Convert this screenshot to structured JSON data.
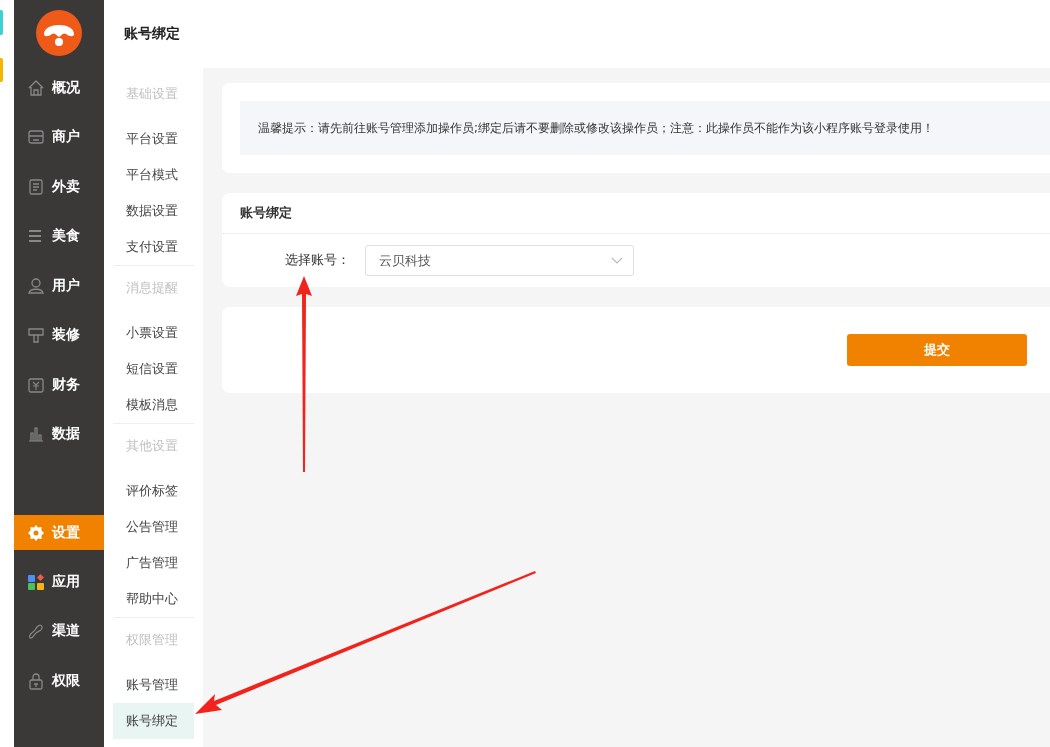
{
  "page_title": "账号绑定",
  "nav": [
    {
      "label": "概况",
      "selected": false
    },
    {
      "label": "商户",
      "selected": false
    },
    {
      "label": "外卖",
      "selected": false
    },
    {
      "label": "美食",
      "selected": false
    },
    {
      "label": "用户",
      "selected": false
    },
    {
      "label": "装修",
      "selected": false
    },
    {
      "label": "财务",
      "selected": false
    },
    {
      "label": "数据",
      "selected": false
    },
    {
      "label": "设置",
      "selected": true
    },
    {
      "label": "应用",
      "selected": false
    },
    {
      "label": "渠道",
      "selected": false
    },
    {
      "label": "权限",
      "selected": false
    }
  ],
  "submenu": [
    {
      "title": "基础设置",
      "items": [
        {
          "label": "平台设置",
          "selected": false
        },
        {
          "label": "平台模式",
          "selected": false
        },
        {
          "label": "数据设置",
          "selected": false
        },
        {
          "label": "支付设置",
          "selected": false
        }
      ]
    },
    {
      "title": "消息提醒",
      "items": [
        {
          "label": "小票设置",
          "selected": false
        },
        {
          "label": "短信设置",
          "selected": false
        },
        {
          "label": "模板消息",
          "selected": false
        }
      ]
    },
    {
      "title": "其他设置",
      "items": [
        {
          "label": "评价标签",
          "selected": false
        },
        {
          "label": "公告管理",
          "selected": false
        },
        {
          "label": "广告管理",
          "selected": false
        },
        {
          "label": "帮助中心",
          "selected": false
        }
      ]
    },
    {
      "title": "权限管理",
      "items": [
        {
          "label": "账号管理",
          "selected": false
        },
        {
          "label": "账号绑定",
          "selected": true
        }
      ]
    }
  ],
  "notice": "温馨提示：请先前往账号管理添加操作员;绑定后请不要删除或修改该操作员；注意：此操作员不能作为该小程序账号登录使用！",
  "form": {
    "title": "账号绑定",
    "label": "选择账号：",
    "value": "云贝科技"
  },
  "submit": "提交"
}
